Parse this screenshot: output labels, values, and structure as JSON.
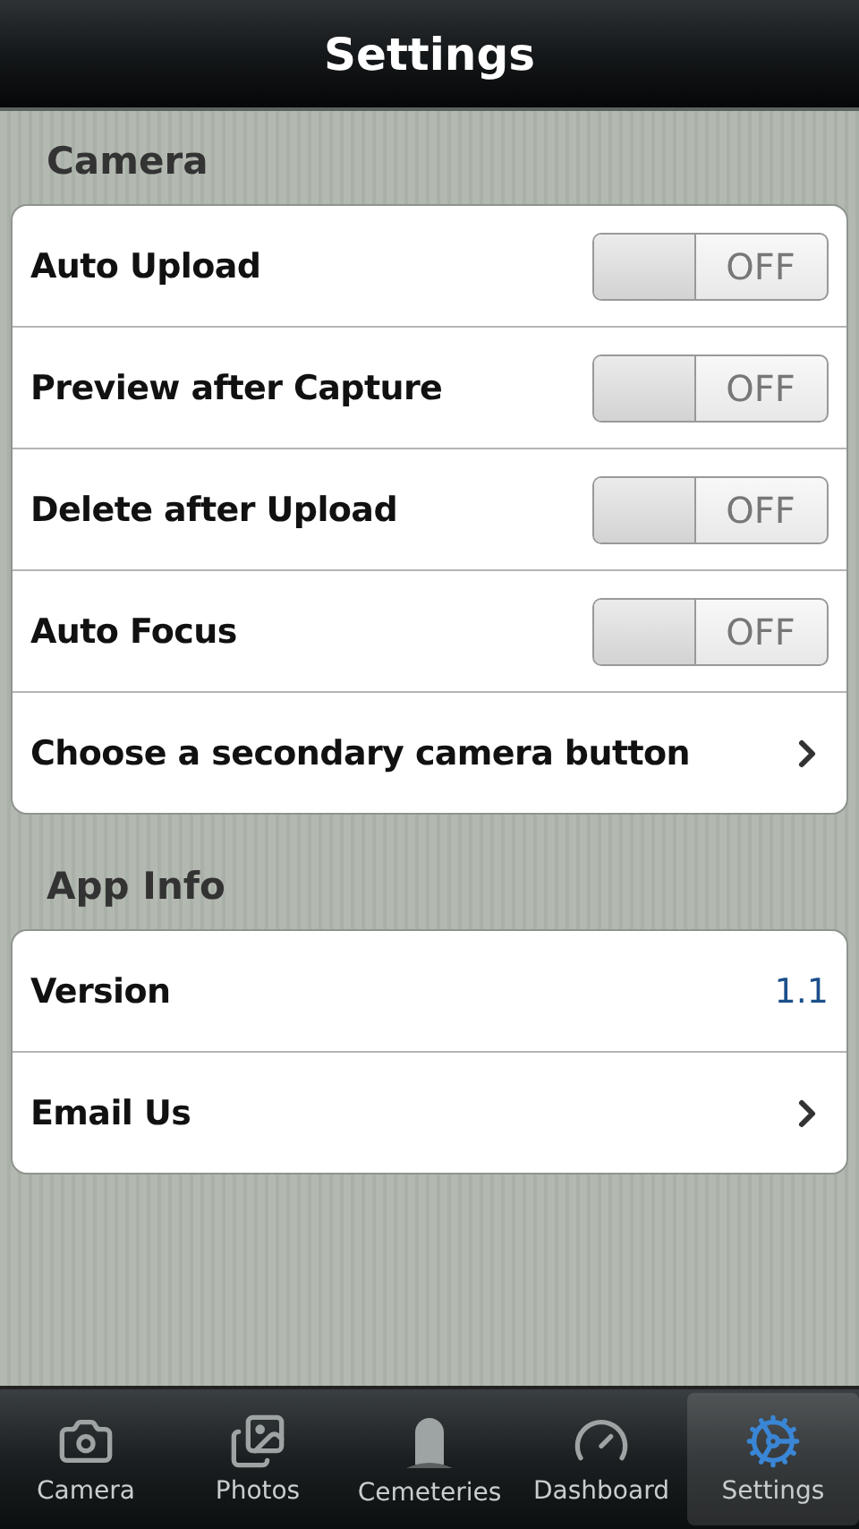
{
  "header": {
    "title": "Settings"
  },
  "sections": [
    {
      "title": "Camera",
      "rows": [
        {
          "kind": "toggle",
          "label": "Auto Upload",
          "on": false,
          "state_text": "OFF"
        },
        {
          "kind": "toggle",
          "label": "Preview after Capture",
          "on": false,
          "state_text": "OFF"
        },
        {
          "kind": "toggle",
          "label": "Delete after Upload",
          "on": false,
          "state_text": "OFF"
        },
        {
          "kind": "toggle",
          "label": "Auto Focus",
          "on": false,
          "state_text": "OFF"
        },
        {
          "kind": "link",
          "label": "Choose a secondary camera button"
        }
      ]
    },
    {
      "title": "App Info",
      "rows": [
        {
          "kind": "value",
          "label": "Version",
          "value": "1.1"
        },
        {
          "kind": "link",
          "label": "Email Us"
        }
      ]
    }
  ],
  "tabs": [
    {
      "kind": "camera",
      "label": "Camera",
      "selected": false
    },
    {
      "kind": "photos",
      "label": "Photos",
      "selected": false
    },
    {
      "kind": "cemeteries",
      "label": "Cemeteries",
      "selected": false
    },
    {
      "kind": "dashboard",
      "label": "Dashboard",
      "selected": false
    },
    {
      "kind": "settings",
      "label": "Settings",
      "selected": true
    }
  ]
}
